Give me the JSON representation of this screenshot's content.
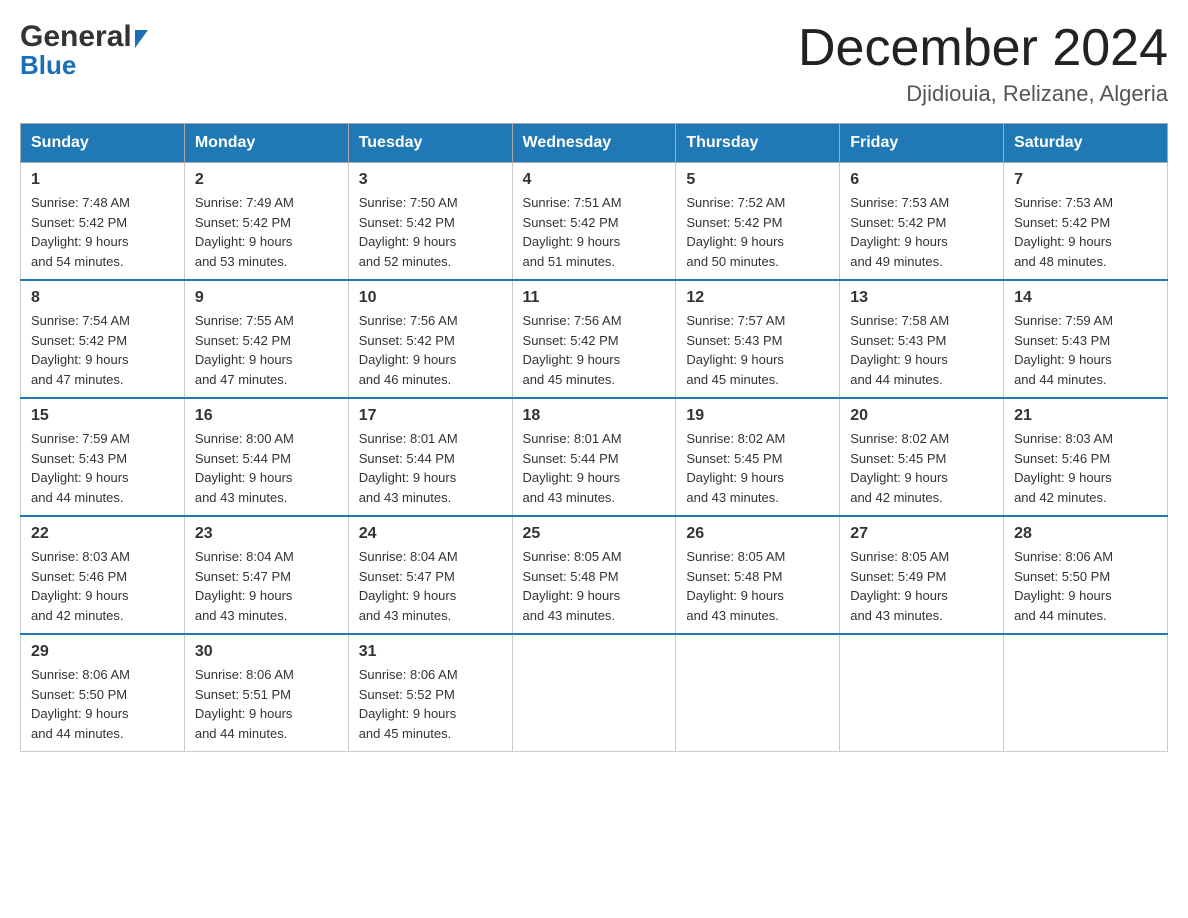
{
  "header": {
    "logo_general": "General",
    "logo_blue": "Blue",
    "month_title": "December 2024",
    "location": "Djidiouia, Relizane, Algeria"
  },
  "days_of_week": [
    "Sunday",
    "Monday",
    "Tuesday",
    "Wednesday",
    "Thursday",
    "Friday",
    "Saturday"
  ],
  "weeks": [
    [
      {
        "day": "1",
        "sunrise": "7:48 AM",
        "sunset": "5:42 PM",
        "daylight": "9 hours and 54 minutes."
      },
      {
        "day": "2",
        "sunrise": "7:49 AM",
        "sunset": "5:42 PM",
        "daylight": "9 hours and 53 minutes."
      },
      {
        "day": "3",
        "sunrise": "7:50 AM",
        "sunset": "5:42 PM",
        "daylight": "9 hours and 52 minutes."
      },
      {
        "day": "4",
        "sunrise": "7:51 AM",
        "sunset": "5:42 PM",
        "daylight": "9 hours and 51 minutes."
      },
      {
        "day": "5",
        "sunrise": "7:52 AM",
        "sunset": "5:42 PM",
        "daylight": "9 hours and 50 minutes."
      },
      {
        "day": "6",
        "sunrise": "7:53 AM",
        "sunset": "5:42 PM",
        "daylight": "9 hours and 49 minutes."
      },
      {
        "day": "7",
        "sunrise": "7:53 AM",
        "sunset": "5:42 PM",
        "daylight": "9 hours and 48 minutes."
      }
    ],
    [
      {
        "day": "8",
        "sunrise": "7:54 AM",
        "sunset": "5:42 PM",
        "daylight": "9 hours and 47 minutes."
      },
      {
        "day": "9",
        "sunrise": "7:55 AM",
        "sunset": "5:42 PM",
        "daylight": "9 hours and 47 minutes."
      },
      {
        "day": "10",
        "sunrise": "7:56 AM",
        "sunset": "5:42 PM",
        "daylight": "9 hours and 46 minutes."
      },
      {
        "day": "11",
        "sunrise": "7:56 AM",
        "sunset": "5:42 PM",
        "daylight": "9 hours and 45 minutes."
      },
      {
        "day": "12",
        "sunrise": "7:57 AM",
        "sunset": "5:43 PM",
        "daylight": "9 hours and 45 minutes."
      },
      {
        "day": "13",
        "sunrise": "7:58 AM",
        "sunset": "5:43 PM",
        "daylight": "9 hours and 44 minutes."
      },
      {
        "day": "14",
        "sunrise": "7:59 AM",
        "sunset": "5:43 PM",
        "daylight": "9 hours and 44 minutes."
      }
    ],
    [
      {
        "day": "15",
        "sunrise": "7:59 AM",
        "sunset": "5:43 PM",
        "daylight": "9 hours and 44 minutes."
      },
      {
        "day": "16",
        "sunrise": "8:00 AM",
        "sunset": "5:44 PM",
        "daylight": "9 hours and 43 minutes."
      },
      {
        "day": "17",
        "sunrise": "8:01 AM",
        "sunset": "5:44 PM",
        "daylight": "9 hours and 43 minutes."
      },
      {
        "day": "18",
        "sunrise": "8:01 AM",
        "sunset": "5:44 PM",
        "daylight": "9 hours and 43 minutes."
      },
      {
        "day": "19",
        "sunrise": "8:02 AM",
        "sunset": "5:45 PM",
        "daylight": "9 hours and 43 minutes."
      },
      {
        "day": "20",
        "sunrise": "8:02 AM",
        "sunset": "5:45 PM",
        "daylight": "9 hours and 42 minutes."
      },
      {
        "day": "21",
        "sunrise": "8:03 AM",
        "sunset": "5:46 PM",
        "daylight": "9 hours and 42 minutes."
      }
    ],
    [
      {
        "day": "22",
        "sunrise": "8:03 AM",
        "sunset": "5:46 PM",
        "daylight": "9 hours and 42 minutes."
      },
      {
        "day": "23",
        "sunrise": "8:04 AM",
        "sunset": "5:47 PM",
        "daylight": "9 hours and 43 minutes."
      },
      {
        "day": "24",
        "sunrise": "8:04 AM",
        "sunset": "5:47 PM",
        "daylight": "9 hours and 43 minutes."
      },
      {
        "day": "25",
        "sunrise": "8:05 AM",
        "sunset": "5:48 PM",
        "daylight": "9 hours and 43 minutes."
      },
      {
        "day": "26",
        "sunrise": "8:05 AM",
        "sunset": "5:48 PM",
        "daylight": "9 hours and 43 minutes."
      },
      {
        "day": "27",
        "sunrise": "8:05 AM",
        "sunset": "5:49 PM",
        "daylight": "9 hours and 43 minutes."
      },
      {
        "day": "28",
        "sunrise": "8:06 AM",
        "sunset": "5:50 PM",
        "daylight": "9 hours and 44 minutes."
      }
    ],
    [
      {
        "day": "29",
        "sunrise": "8:06 AM",
        "sunset": "5:50 PM",
        "daylight": "9 hours and 44 minutes."
      },
      {
        "day": "30",
        "sunrise": "8:06 AM",
        "sunset": "5:51 PM",
        "daylight": "9 hours and 44 minutes."
      },
      {
        "day": "31",
        "sunrise": "8:06 AM",
        "sunset": "5:52 PM",
        "daylight": "9 hours and 45 minutes."
      },
      null,
      null,
      null,
      null
    ]
  ]
}
